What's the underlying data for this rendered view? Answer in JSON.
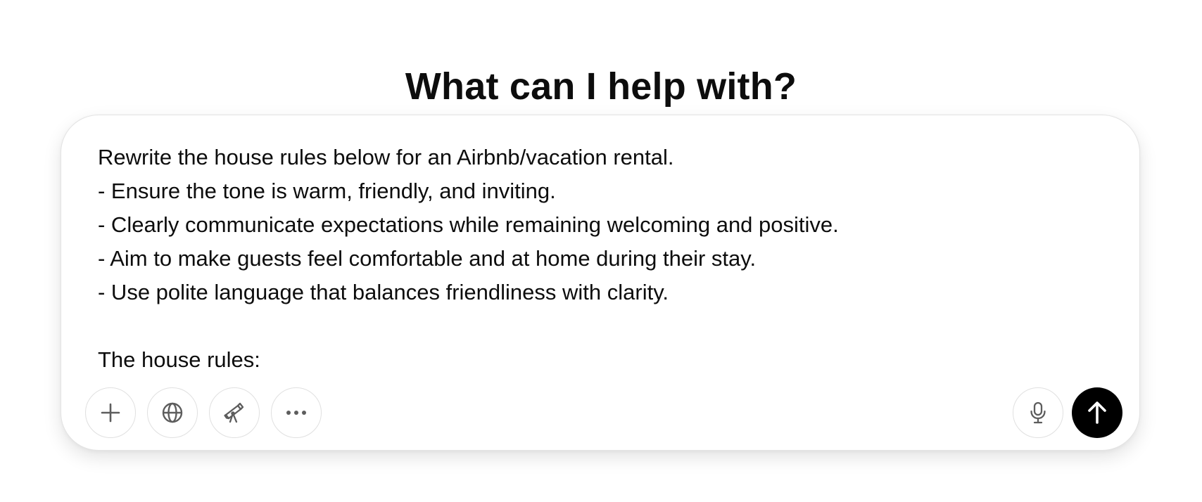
{
  "header": {
    "title": "What can I help with?"
  },
  "composer": {
    "prompt_text": "Rewrite the house rules below for an Airbnb/vacation rental.\n- Ensure the tone is warm, friendly, and inviting.\n- Clearly communicate expectations while remaining welcoming and positive.\n- Aim to make guests feel comfortable and at home during their stay.\n- Use polite language that balances friendliness with clarity.\n\nThe house rules:",
    "toolbar_left": [
      {
        "icon": "plus-icon"
      },
      {
        "icon": "globe-icon"
      },
      {
        "icon": "telescope-icon"
      },
      {
        "icon": "more-icon"
      }
    ],
    "toolbar_right": [
      {
        "icon": "microphone-icon"
      },
      {
        "icon": "arrow-up-icon"
      }
    ]
  },
  "colors": {
    "text": "#0d0d0d",
    "icon": "#5d5d5d",
    "border": "#e0e0e0",
    "send_bg": "#000000",
    "send_fg": "#ffffff"
  }
}
